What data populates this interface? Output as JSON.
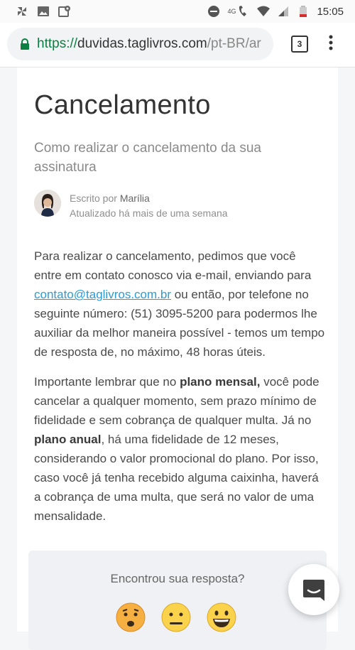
{
  "status_bar": {
    "time": "15:05",
    "network": "4G",
    "icons": [
      "pinwheel-icon",
      "image-icon",
      "location-image-icon",
      "do-not-disturb-icon",
      "phone-wifi-icon",
      "wifi-icon",
      "signal-icon",
      "battery-low-icon"
    ]
  },
  "browser": {
    "url_scheme": "https://",
    "url_host": "duvidas.taglivros.com",
    "url_path": "/pt-BR/ar",
    "tab_count": "3",
    "lock_color": "#0b8043"
  },
  "article": {
    "title": "Cancelamento",
    "subtitle": "Como realizar o cancelamento da sua assinatura",
    "author_prefix": "Escrito por",
    "author_name": "Marília",
    "updated": "Atualizado há mais de uma semana",
    "p1_part1": "Para realizar o cancelamento, pedimos que você entre em contato conosco via e-mail, enviando para",
    "p1_email": "contato@taglivros.com.br",
    "p1_part2": "ou então, por telefone no seguinte número: (51) 3095-5200 para podermos lhe auxiliar da melhor maneira possível - temos um tempo de resposta de, no máximo, 48 horas úteis.",
    "p2_part1": "Importante lembrar que no",
    "p2_bold1": "plano mensal,",
    "p2_part2": "você pode cancelar a qualquer momento, sem prazo mínimo de fidelidade e sem cobrança de qualquer multa. Já no",
    "p2_bold2": "plano anual",
    "p2_part3": ", há uma fidelidade de 12 meses, considerando o valor promocional do plano. Por isso, caso você já tenha recebido alguma caixinha, haverá a cobrança de uma multa, que será no valor de uma mensalidade.",
    "link_color": "#2b9bd6"
  },
  "feedback": {
    "question": "Encontrou sua resposta?",
    "reactions": [
      "sad-face",
      "neutral-face",
      "smiley-face"
    ]
  },
  "chat": {
    "icon": "chat-bubble-icon"
  }
}
